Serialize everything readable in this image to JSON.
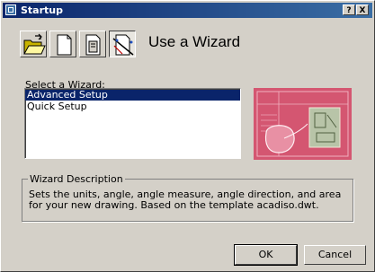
{
  "window": {
    "title": "Startup"
  },
  "titlebar": {
    "help": "?",
    "close": "X"
  },
  "toolbar": {
    "icons": [
      "open-drawing-icon",
      "start-from-scratch-icon",
      "use-template-icon",
      "use-wizard-icon"
    ],
    "active": "use-wizard"
  },
  "heading": "Use a Wizard",
  "wizard_list": {
    "label": "Select a Wizard:",
    "items": [
      "Advanced Setup",
      "Quick Setup"
    ],
    "selected": "Advanced Setup"
  },
  "description": {
    "legend": "Wizard Description",
    "text": "Sets the units, angle, angle measure, angle direction, and area for your new drawing. Based on the template acadiso.dwt."
  },
  "buttons": {
    "ok": "OK",
    "cancel": "Cancel"
  },
  "colors": {
    "titlebar": "#0a246a",
    "selection": "#0a246a",
    "face": "#d4d0c8",
    "preview": "#d24a64"
  }
}
